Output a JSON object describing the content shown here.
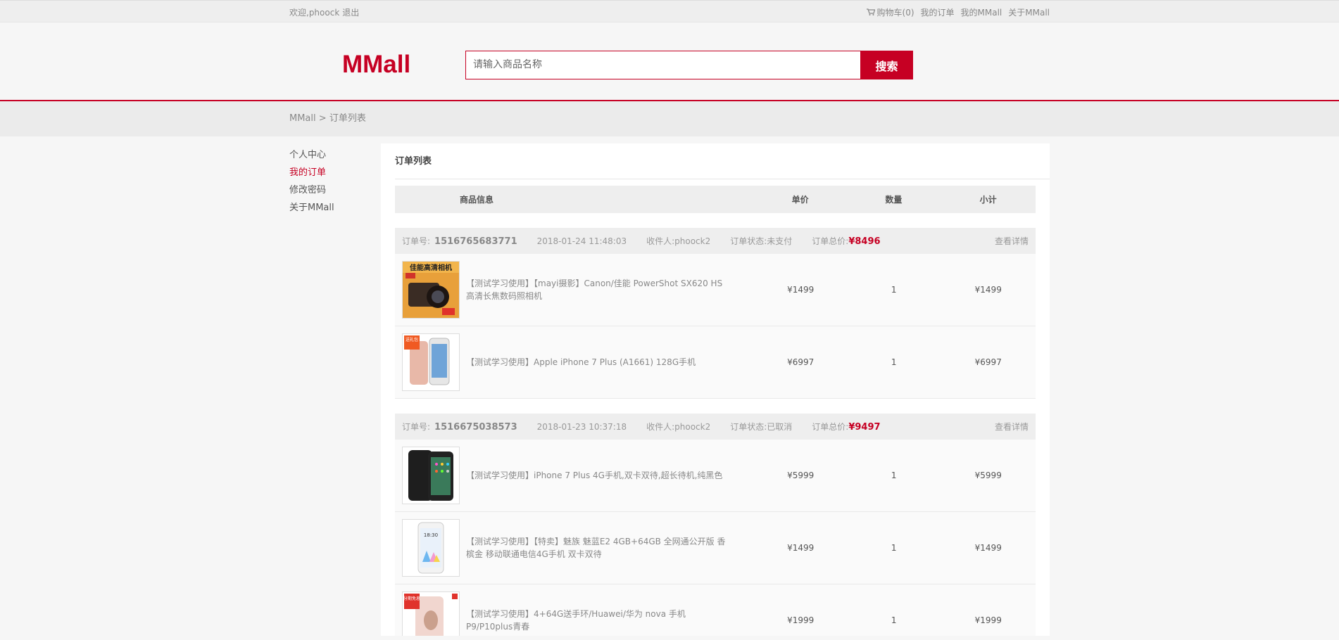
{
  "topbar": {
    "welcome": "欢迎,phoock",
    "logout": "退出",
    "cart": "购物车(0)",
    "my_orders": "我的订单",
    "my_mmall": "我的MMall",
    "about": "关于MMall"
  },
  "header": {
    "logo": "MMall",
    "search_placeholder": "请输入商品名称",
    "search_button": "搜索"
  },
  "breadcrumb": {
    "home": "MMall",
    "sep": ">",
    "current": "订单列表"
  },
  "sidebar": {
    "items": [
      {
        "label": "个人中心",
        "active": false
      },
      {
        "label": "我的订单",
        "active": true
      },
      {
        "label": "修改密码",
        "active": false
      },
      {
        "label": "关于MMall",
        "active": false
      }
    ]
  },
  "panel": {
    "title": "订单列表",
    "columns": {
      "info": "商品信息",
      "price": "单价",
      "count": "数量",
      "total": "小计"
    }
  },
  "labels": {
    "order_no": "订单号:",
    "receiver": "收件人:",
    "status": "订单状态:",
    "total": "订单总价:",
    "detail": "查看详情",
    "currency": "¥"
  },
  "orders": [
    {
      "order_no": "1516765683771",
      "time": "2018-01-24 11:48:03",
      "receiver": "phoock2",
      "status": "未支付",
      "total": "¥8496",
      "items": [
        {
          "name": "【测试学习使用】【mayi摄影】Canon/佳能 PowerShot SX620 HS高清长焦数码照相机",
          "price": "¥1499",
          "count": "1",
          "subtotal": "¥1499",
          "thumb": "camera",
          "thumb_text": "佳能高清相机"
        },
        {
          "name": "【测试学习使用】Apple iPhone 7 Plus (A1661) 128G手机",
          "price": "¥6997",
          "count": "1",
          "subtotal": "¥6997",
          "thumb": "iphone-rose",
          "thumb_text": "送礼包"
        }
      ]
    },
    {
      "order_no": "1516675038573",
      "time": "2018-01-23 10:37:18",
      "receiver": "phoock2",
      "status": "已取消",
      "total": "¥9497",
      "items": [
        {
          "name": "【测试学习使用】iPhone 7 Plus 4G手机,双卡双待,超长待机,纯黑色",
          "price": "¥5999",
          "count": "1",
          "subtotal": "¥5999",
          "thumb": "iphone-black",
          "thumb_text": ""
        },
        {
          "name": "【测试学习使用】【特卖】魅族 魅蓝E2 4GB+64GB 全网通公开版 香槟金 移动联通电信4G手机 双卡双待",
          "price": "¥1499",
          "count": "1",
          "subtotal": "¥1499",
          "thumb": "meizu",
          "thumb_text": "18:30"
        },
        {
          "name": "【测试学习使用】4+64G送手环/Huawei/华为 nova 手机P9/P10plus青春",
          "price": "¥1999",
          "count": "1",
          "subtotal": "¥1999",
          "thumb": "huawei",
          "thumb_text": "分期免息"
        }
      ]
    }
  ]
}
